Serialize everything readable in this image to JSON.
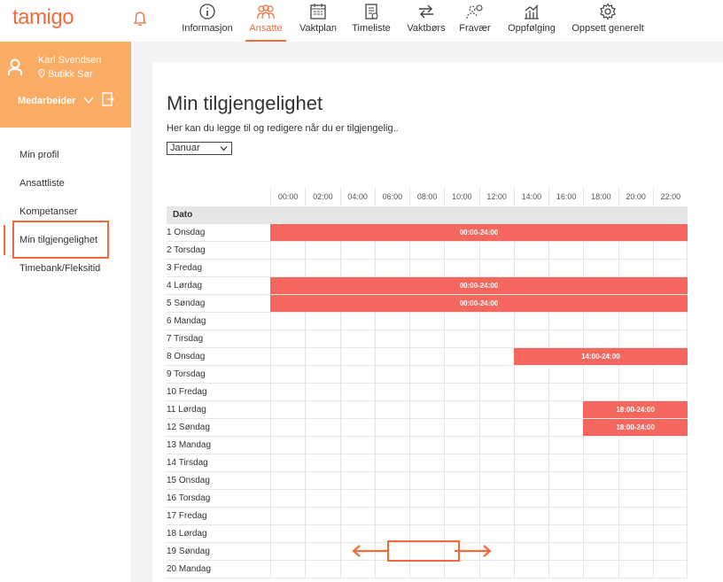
{
  "app": {
    "logo": "tamigo"
  },
  "nav": [
    {
      "label": "Informasjon",
      "icon": "info-icon",
      "active": false
    },
    {
      "label": "Ansatte",
      "icon": "employees-icon",
      "active": true
    },
    {
      "label": "Vaktplan",
      "icon": "schedule-icon",
      "active": false
    },
    {
      "label": "Timeliste",
      "icon": "timesheet-icon",
      "active": false
    },
    {
      "label": "Vaktbørs",
      "icon": "shift-exchange-icon",
      "active": false
    },
    {
      "label": "Fravær",
      "icon": "absence-icon",
      "active": false
    },
    {
      "label": "Oppfølging",
      "icon": "followup-icon",
      "active": false
    },
    {
      "label": "Oppsett generelt",
      "icon": "settings-gear-icon",
      "active": false
    }
  ],
  "user": {
    "name": "Karl Svendsen",
    "store": "Butikk Sør",
    "role": "Medarbeider"
  },
  "sidebar": {
    "items": [
      {
        "label": "Min profil"
      },
      {
        "label": "Ansattliste"
      },
      {
        "label": "Kompetanser"
      },
      {
        "label": "Min tilgjengelighet"
      },
      {
        "label": "Timebank/Fleksitid"
      }
    ]
  },
  "main": {
    "title": "Min tilgjengelighet",
    "subtitle": "Her kan du legge til og redigere når du er tilgjengelig..",
    "month": {
      "selected": "Januar"
    }
  },
  "grid": {
    "hours": [
      "00:00",
      "02:00",
      "04:00",
      "06:00",
      "08:00",
      "10:00",
      "12:00",
      "14:00",
      "16:00",
      "18:00",
      "20:00",
      "22:00"
    ],
    "date_header": "Dato",
    "rows": [
      {
        "label": "1 Onsdag",
        "slot": {
          "text": "00:00-24:00",
          "start": 0,
          "end": 24
        }
      },
      {
        "label": "2 Torsdag"
      },
      {
        "label": "3 Fredag"
      },
      {
        "label": "4 Lørdag",
        "slot": {
          "text": "00:00-24:00",
          "start": 0,
          "end": 24
        }
      },
      {
        "label": "5 Søndag",
        "slot": {
          "text": "00:00-24:00",
          "start": 0,
          "end": 24
        }
      },
      {
        "label": "6 Mandag"
      },
      {
        "label": "7 Tirsdag"
      },
      {
        "label": "8 Onsdag",
        "slot": {
          "text": "14:00-24:00",
          "start": 14,
          "end": 24
        }
      },
      {
        "label": "9 Torsdag"
      },
      {
        "label": "10 Fredag"
      },
      {
        "label": "11 Lørdag",
        "slot": {
          "text": "18:00-24:00",
          "start": 18,
          "end": 24
        }
      },
      {
        "label": "12 Søndag",
        "slot": {
          "text": "18:00-24:00",
          "start": 18,
          "end": 24
        }
      },
      {
        "label": "13 Mandag"
      },
      {
        "label": "14 Tirsdag"
      },
      {
        "label": "15 Onsdag"
      },
      {
        "label": "16 Torsdag"
      },
      {
        "label": "17 Fredag"
      },
      {
        "label": "18 Lørdag"
      },
      {
        "label": "19 Søndag"
      },
      {
        "label": "20 Mandag"
      }
    ]
  },
  "colors": {
    "accent": "#f26b3a",
    "slot": "#f4675f",
    "sidebar_user": "#fbac64"
  }
}
